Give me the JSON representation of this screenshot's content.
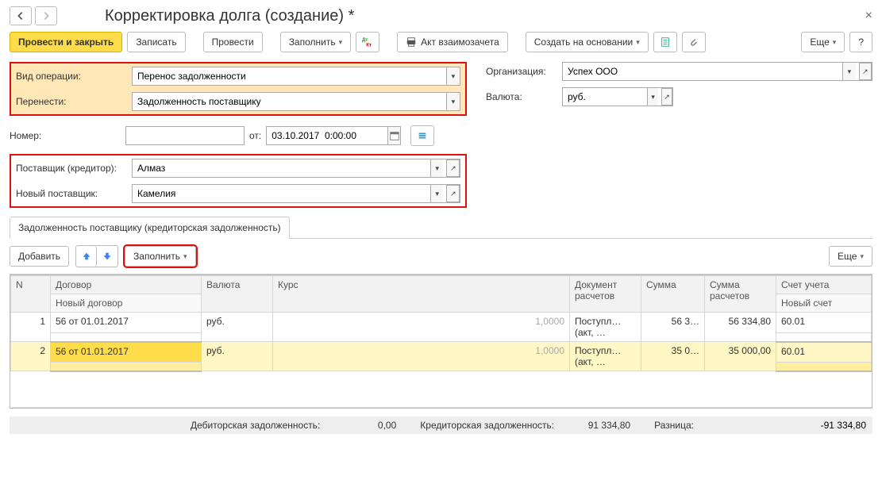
{
  "page": {
    "title": "Корректировка долга (создание) *"
  },
  "toolbar": {
    "submit_close": "Провести и закрыть",
    "save": "Записать",
    "post": "Провести",
    "fill": "Заполнить",
    "act": "Акт взаимозачета",
    "create_based": "Создать на основании",
    "more": "Еще",
    "help": "?"
  },
  "form": {
    "op_type_label": "Вид операции:",
    "op_type_value": "Перенос задолженности",
    "transfer_label": "Перенести:",
    "transfer_value": "Задолженность поставщику",
    "number_label": "Номер:",
    "number_value": "",
    "from_label": "от:",
    "date_value": "03.10.2017  0:00:00",
    "supplier_label": "Поставщик (кредитор):",
    "supplier_value": "Алмаз",
    "new_supplier_label": "Новый поставщик:",
    "new_supplier_value": "Камелия",
    "org_label": "Организация:",
    "org_value": "Успех ООО",
    "currency_label": "Валюта:",
    "currency_value": "руб."
  },
  "tabs": {
    "tab1": "Задолженность поставщику (кредиторская задолженность)"
  },
  "grid_toolbar": {
    "add": "Добавить",
    "fill": "Заполнить",
    "more": "Еще"
  },
  "grid": {
    "headers": {
      "n": "N",
      "contract": "Договор",
      "new_contract": "Новый договор",
      "currency": "Валюта",
      "rate": "Курс",
      "doc": "Документ расчетов",
      "sum": "Сумма",
      "sum_settle": "Сумма расчетов",
      "account": "Счет учета",
      "new_account": "Новый счет"
    },
    "rows": [
      {
        "n": "1",
        "contract": "56 от 01.01.2017",
        "currency": "руб.",
        "rate": "1,0000",
        "doc": "Поступл… (акт, …",
        "sum": "56 3…",
        "sum_settle": "56 334,80",
        "account": "60.01"
      },
      {
        "n": "2",
        "contract": "56 от 01.01.2017",
        "currency": "руб.",
        "rate": "1,0000",
        "doc": "Поступл… (акт, …",
        "sum": "35 0…",
        "sum_settle": "35 000,00",
        "account": "60.01"
      }
    ]
  },
  "footer": {
    "debit_label": "Дебиторская задолженность:",
    "debit_value": "0,00",
    "credit_label": "Кредиторская задолженность:",
    "credit_value": "91 334,80",
    "diff_label": "Разница:",
    "diff_value": "-91 334,80"
  }
}
